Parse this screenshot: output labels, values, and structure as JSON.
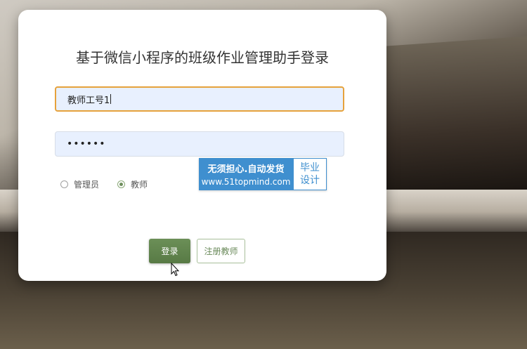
{
  "login": {
    "title": "基于微信小程序的班级作业管理助手登录",
    "username_value": "教师工号1",
    "password_mask": "••••••",
    "roles": [
      {
        "label": "管理员",
        "checked": false
      },
      {
        "label": "教师",
        "checked": true
      }
    ],
    "login_button": "登录",
    "register_button": "注册教师"
  },
  "watermark": {
    "line1": "无须担心.自动发货",
    "line2": "www.51topmind.com",
    "badge_line1": "毕业",
    "badge_line2": "设计"
  },
  "colors": {
    "accent_green": "#6b8f57",
    "focus_orange": "#e6a23c",
    "input_bg": "#e8f0fe",
    "watermark_blue": "#3f8fcf"
  }
}
